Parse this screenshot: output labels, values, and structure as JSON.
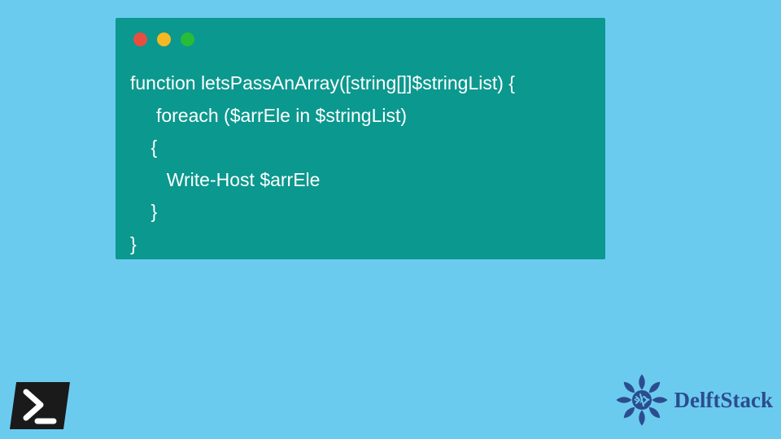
{
  "code": {
    "lines": [
      "function letsPassAnArray([string[]]$stringList) {",
      "     foreach ($arrEle in $stringList)",
      "    {",
      "       Write-Host $arrEle",
      "    }",
      "}"
    ]
  },
  "branding": {
    "site_name": "DelftStack"
  },
  "colors": {
    "page_bg": "#6bcbef",
    "window_bg": "#0b988e",
    "code_text": "#ffffff",
    "traffic_red": "#e84e40",
    "traffic_yellow": "#f5b823",
    "traffic_green": "#28bc38",
    "brand_blue": "#2b4d8f"
  },
  "icons": {
    "bottom_left": "powershell-icon",
    "bottom_right": "delftstack-emblem-icon"
  }
}
